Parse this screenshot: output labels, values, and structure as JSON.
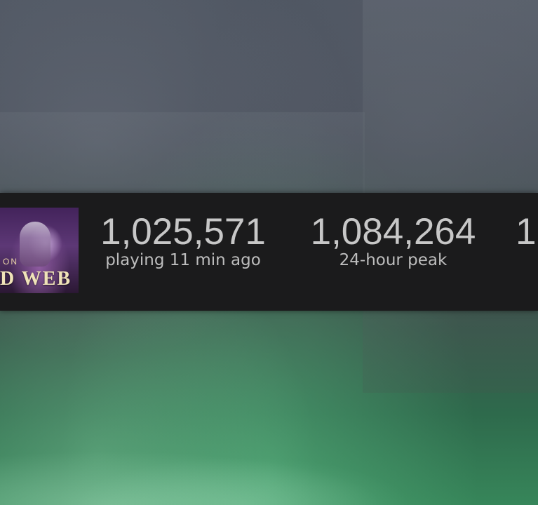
{
  "game": {
    "thumbnail_small_text": "ON",
    "thumbnail_title": "D WEB"
  },
  "stats": [
    {
      "value": "1,025,571",
      "label": "playing 11 min ago"
    },
    {
      "value": "1,084,264",
      "label": "24-hour peak"
    },
    {
      "value": "1,",
      "label": ""
    }
  ]
}
